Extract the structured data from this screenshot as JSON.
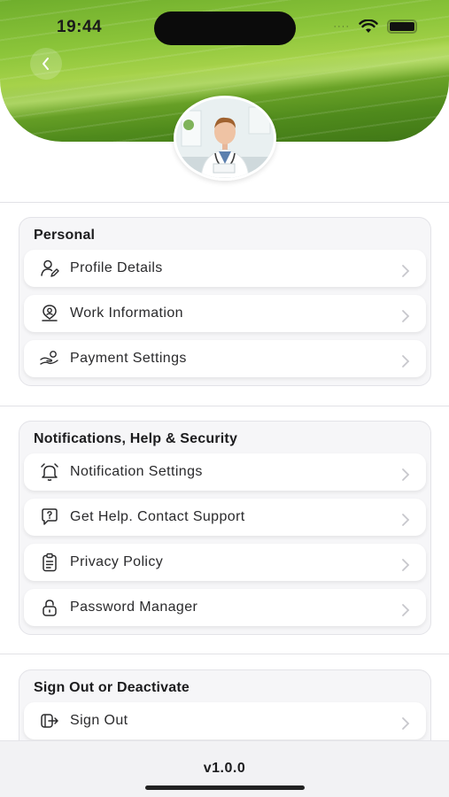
{
  "status_bar": {
    "time": "19:44"
  },
  "sections": {
    "personal": {
      "title": "Personal",
      "items": [
        {
          "label": "Profile Details",
          "icon": "user-edit-icon"
        },
        {
          "label": "Work Information",
          "icon": "location-user-icon"
        },
        {
          "label": "Payment Settings",
          "icon": "hand-coin-icon"
        }
      ]
    },
    "notifications": {
      "title": "Notifications, Help & Security",
      "items": [
        {
          "label": "Notification Settings",
          "icon": "alarm-bell-icon"
        },
        {
          "label": "Get Help. Contact Support",
          "icon": "help-chat-icon"
        },
        {
          "label": "Privacy Policy",
          "icon": "clipboard-icon"
        },
        {
          "label": "Password Manager",
          "icon": "lock-icon"
        }
      ]
    },
    "signout": {
      "title": "Sign Out or Deactivate",
      "items": [
        {
          "label": "Sign Out",
          "icon": "sign-out-icon"
        }
      ]
    }
  },
  "footer": {
    "version": "v1.0.0"
  },
  "colors": {
    "banner_green": "#6fae2c",
    "card_bg": "#ffffff",
    "section_bg": "#f6f6f8"
  }
}
